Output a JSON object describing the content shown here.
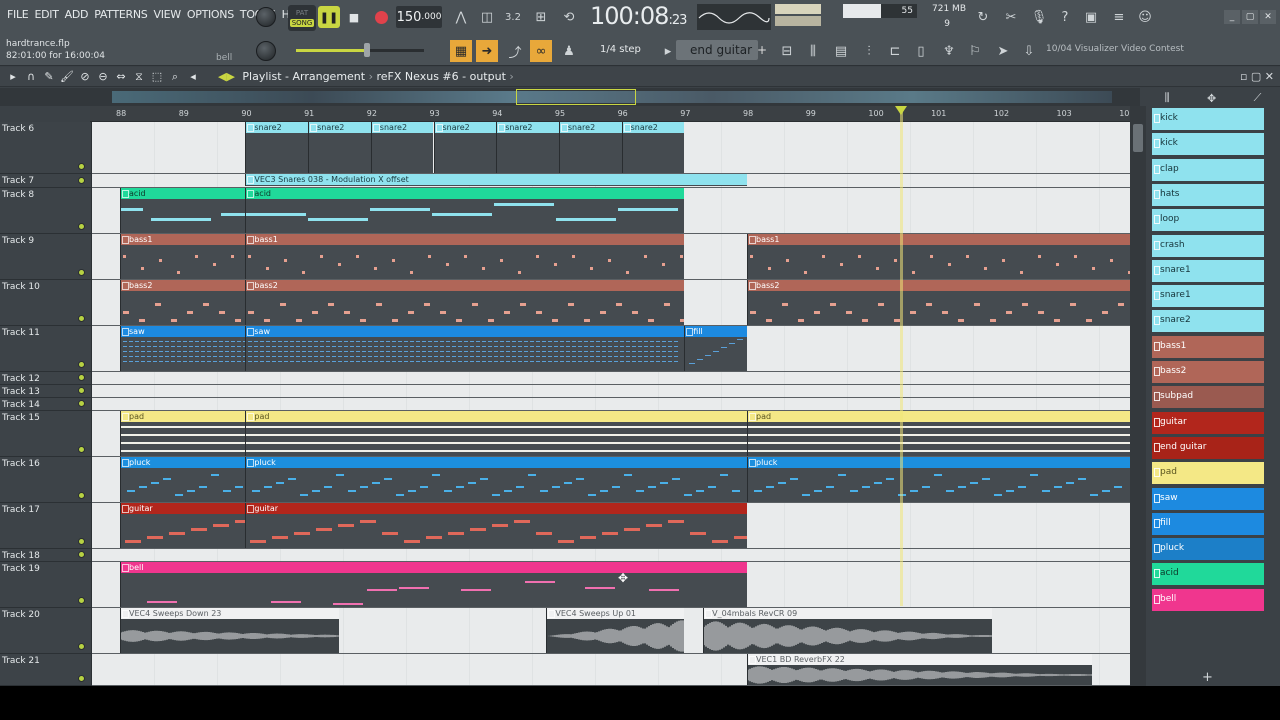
{
  "menu": [
    "FILE",
    "EDIT",
    "ADD",
    "PATTERNS",
    "VIEW",
    "OPTIONS",
    "TOOLS",
    "HELP"
  ],
  "song": {
    "file": "hardtrance.flp",
    "position": "82:01:00 for 16:00:04",
    "hint": "bell"
  },
  "transport": {
    "pat": "PAT",
    "song": "SONG",
    "tempo_int": "150",
    "tempo_frac": ".000",
    "clock_main": "100:08",
    "clock_sub": ":23",
    "cpu": "55",
    "memory": "721 MB",
    "polyphony": "9"
  },
  "snap": "1/4 step",
  "pattern_selector": "end guitar",
  "news": "10/04  Visualizer Video Contest",
  "playlist_title": "Playlist - Arrangement",
  "playlist_path": "reFX Nexus #6 - output",
  "ruler": [
    "88",
    "89",
    "90",
    "91",
    "92",
    "93",
    "94",
    "95",
    "96",
    "97",
    "98",
    "99",
    "100",
    "101",
    "102",
    "103",
    "10"
  ],
  "tracks": [
    {
      "name": "Track 6"
    },
    {
      "name": "Track 7"
    },
    {
      "name": "Track 8"
    },
    {
      "name": "Track 9"
    },
    {
      "name": "Track 10"
    },
    {
      "name": "Track 11"
    },
    {
      "name": "Track 12"
    },
    {
      "name": "Track 13"
    },
    {
      "name": "Track 14"
    },
    {
      "name": "Track 15"
    },
    {
      "name": "Track 16"
    },
    {
      "name": "Track 17"
    },
    {
      "name": "Track 18"
    },
    {
      "name": "Track 19"
    },
    {
      "name": "Track 20"
    },
    {
      "name": "Track 21"
    }
  ],
  "clips": {
    "snare2": "snare2",
    "automation": "VEC3 Snares 038 - Modulation X offset",
    "acid": "acid",
    "bass1": "bass1",
    "bass2": "bass2",
    "saw": "saw",
    "fill": "fill",
    "pad": "pad",
    "pluck": "pluck",
    "guitar": "guitar",
    "bell": "bell",
    "sweeps_down": "VEC4 Sweeps Down 23",
    "sweeps_up": "VEC4 Sweeps Up 01",
    "revcr": "V_04mbals RevCR 09",
    "bd_reverb": "VEC1 BD ReverbFX 22"
  },
  "colors": {
    "snare": "#8fe2ee",
    "acid": "#20d99a",
    "bass": "#b06658",
    "saw": "#1d8ae0",
    "pad": "#f4e886",
    "pluck": "#1c8fde",
    "guitar": "#b2261c",
    "bell": "#f0368e",
    "audio": "#f0f1f2",
    "accent": "#c9d642"
  },
  "picker": [
    {
      "label": "kick",
      "color": "#8fe2ee",
      "text": "#16343a"
    },
    {
      "label": "kick",
      "color": "#8fe2ee",
      "text": "#16343a"
    },
    {
      "label": "clap",
      "color": "#8fe2ee",
      "text": "#16343a"
    },
    {
      "label": "hats",
      "color": "#8fe2ee",
      "text": "#16343a"
    },
    {
      "label": "loop",
      "color": "#8fe2ee",
      "text": "#16343a"
    },
    {
      "label": "crash",
      "color": "#8fe2ee",
      "text": "#16343a"
    },
    {
      "label": "snare1",
      "color": "#8fe2ee",
      "text": "#16343a"
    },
    {
      "label": "snare1",
      "color": "#8fe2ee",
      "text": "#16343a"
    },
    {
      "label": "snare2",
      "color": "#8fe2ee",
      "text": "#16343a"
    },
    {
      "label": "bass1",
      "color": "#b06658",
      "text": "#ffffff"
    },
    {
      "label": "bass2",
      "color": "#b06658",
      "text": "#ffffff"
    },
    {
      "label": "subpad",
      "color": "#9a5a50",
      "text": "#ffffff"
    },
    {
      "label": "guitar",
      "color": "#b2261c",
      "text": "#ffffff"
    },
    {
      "label": "end guitar",
      "color": "#a82318",
      "text": "#ffffff"
    },
    {
      "label": "pad",
      "color": "#f4e886",
      "text": "#5a5520"
    },
    {
      "label": "saw",
      "color": "#1d8ae0",
      "text": "#ffffff"
    },
    {
      "label": "fill",
      "color": "#1d8ae0",
      "text": "#ffffff"
    },
    {
      "label": "pluck",
      "color": "#1c7fc8",
      "text": "#ffffff"
    },
    {
      "label": "acid",
      "color": "#20d99a",
      "text": "#0c3a2a"
    },
    {
      "label": "bell",
      "color": "#f0368e",
      "text": "#ffffff"
    }
  ]
}
